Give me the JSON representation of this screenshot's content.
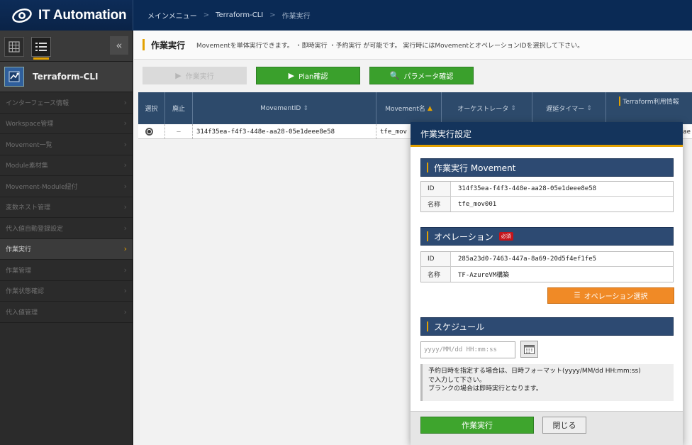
{
  "app": {
    "title": "IT Automation"
  },
  "breadcrumb": {
    "items": [
      "メインメニュー",
      "Terraform-CLI",
      "作業実行"
    ]
  },
  "sidebar": {
    "menu_title": "Terraform-CLI",
    "items": [
      {
        "label": "インターフェース情報"
      },
      {
        "label": "Workspace管理"
      },
      {
        "label": "Movement一覧"
      },
      {
        "label": "Module素材集"
      },
      {
        "label": "Movement-Module紐付"
      },
      {
        "label": "変数ネスト管理"
      },
      {
        "label": "代入値自動登録設定"
      },
      {
        "label": "作業実行",
        "active": true
      },
      {
        "label": "作業管理"
      },
      {
        "label": "作業状態確認"
      },
      {
        "label": "代入値管理"
      }
    ]
  },
  "page": {
    "title": "作業実行",
    "description": "Movementを単体実行できます。 ・即時実行 ・予約実行 が可能です。 実行時にはMovementとオペレーションIDを選択して下さい。"
  },
  "toolbar": {
    "execute_label": "作業実行",
    "plan_label": "Plan確認",
    "param_label": "パラメータ確認"
  },
  "table": {
    "headers": [
      "選択",
      "廃止",
      "MovementID",
      "Movement名",
      "オーケストレータ",
      "遅延タイマー",
      "Terraform利用情報"
    ],
    "rows": [
      {
        "abolish": "—",
        "id": "314f35ea-f4f3-448e-aa28-05e1deee8e58",
        "name": "tfe_mov",
        "tail": "ae"
      }
    ]
  },
  "modal": {
    "title": "作業実行設定",
    "movement_section": "作業実行 Movement",
    "movement": {
      "id_label": "ID",
      "id": "314f35ea-f4f3-448e-aa28-05e1deee8e58",
      "name_label": "名称",
      "name": "tfe_mov001"
    },
    "operation_section": "オペレーション",
    "required": "必須",
    "operation": {
      "id_label": "ID",
      "id": "285a23d0-7463-447a-8a69-20d5f4ef1fe5",
      "name_label": "名称",
      "name": "TF-AzureVM構築"
    },
    "operation_select_label": "オペレーション選択",
    "schedule_section": "スケジュール",
    "schedule_placeholder": "yyyy/MM/dd HH:mm:ss",
    "note_lines": [
      "予約日時を指定する場合は、日時フォーマット(yyyy/MM/dd HH:mm:ss)",
      "で入力して下さい。",
      "ブランクの場合は即時実行となります。"
    ],
    "execute_label": "作業実行",
    "close_label": "閉じる"
  },
  "colors": {
    "header_bg": "#0a2a55",
    "accent": "#e3a100",
    "green": "#3aa02c",
    "orange": "#f08a26",
    "required_red": "#c4151c"
  }
}
